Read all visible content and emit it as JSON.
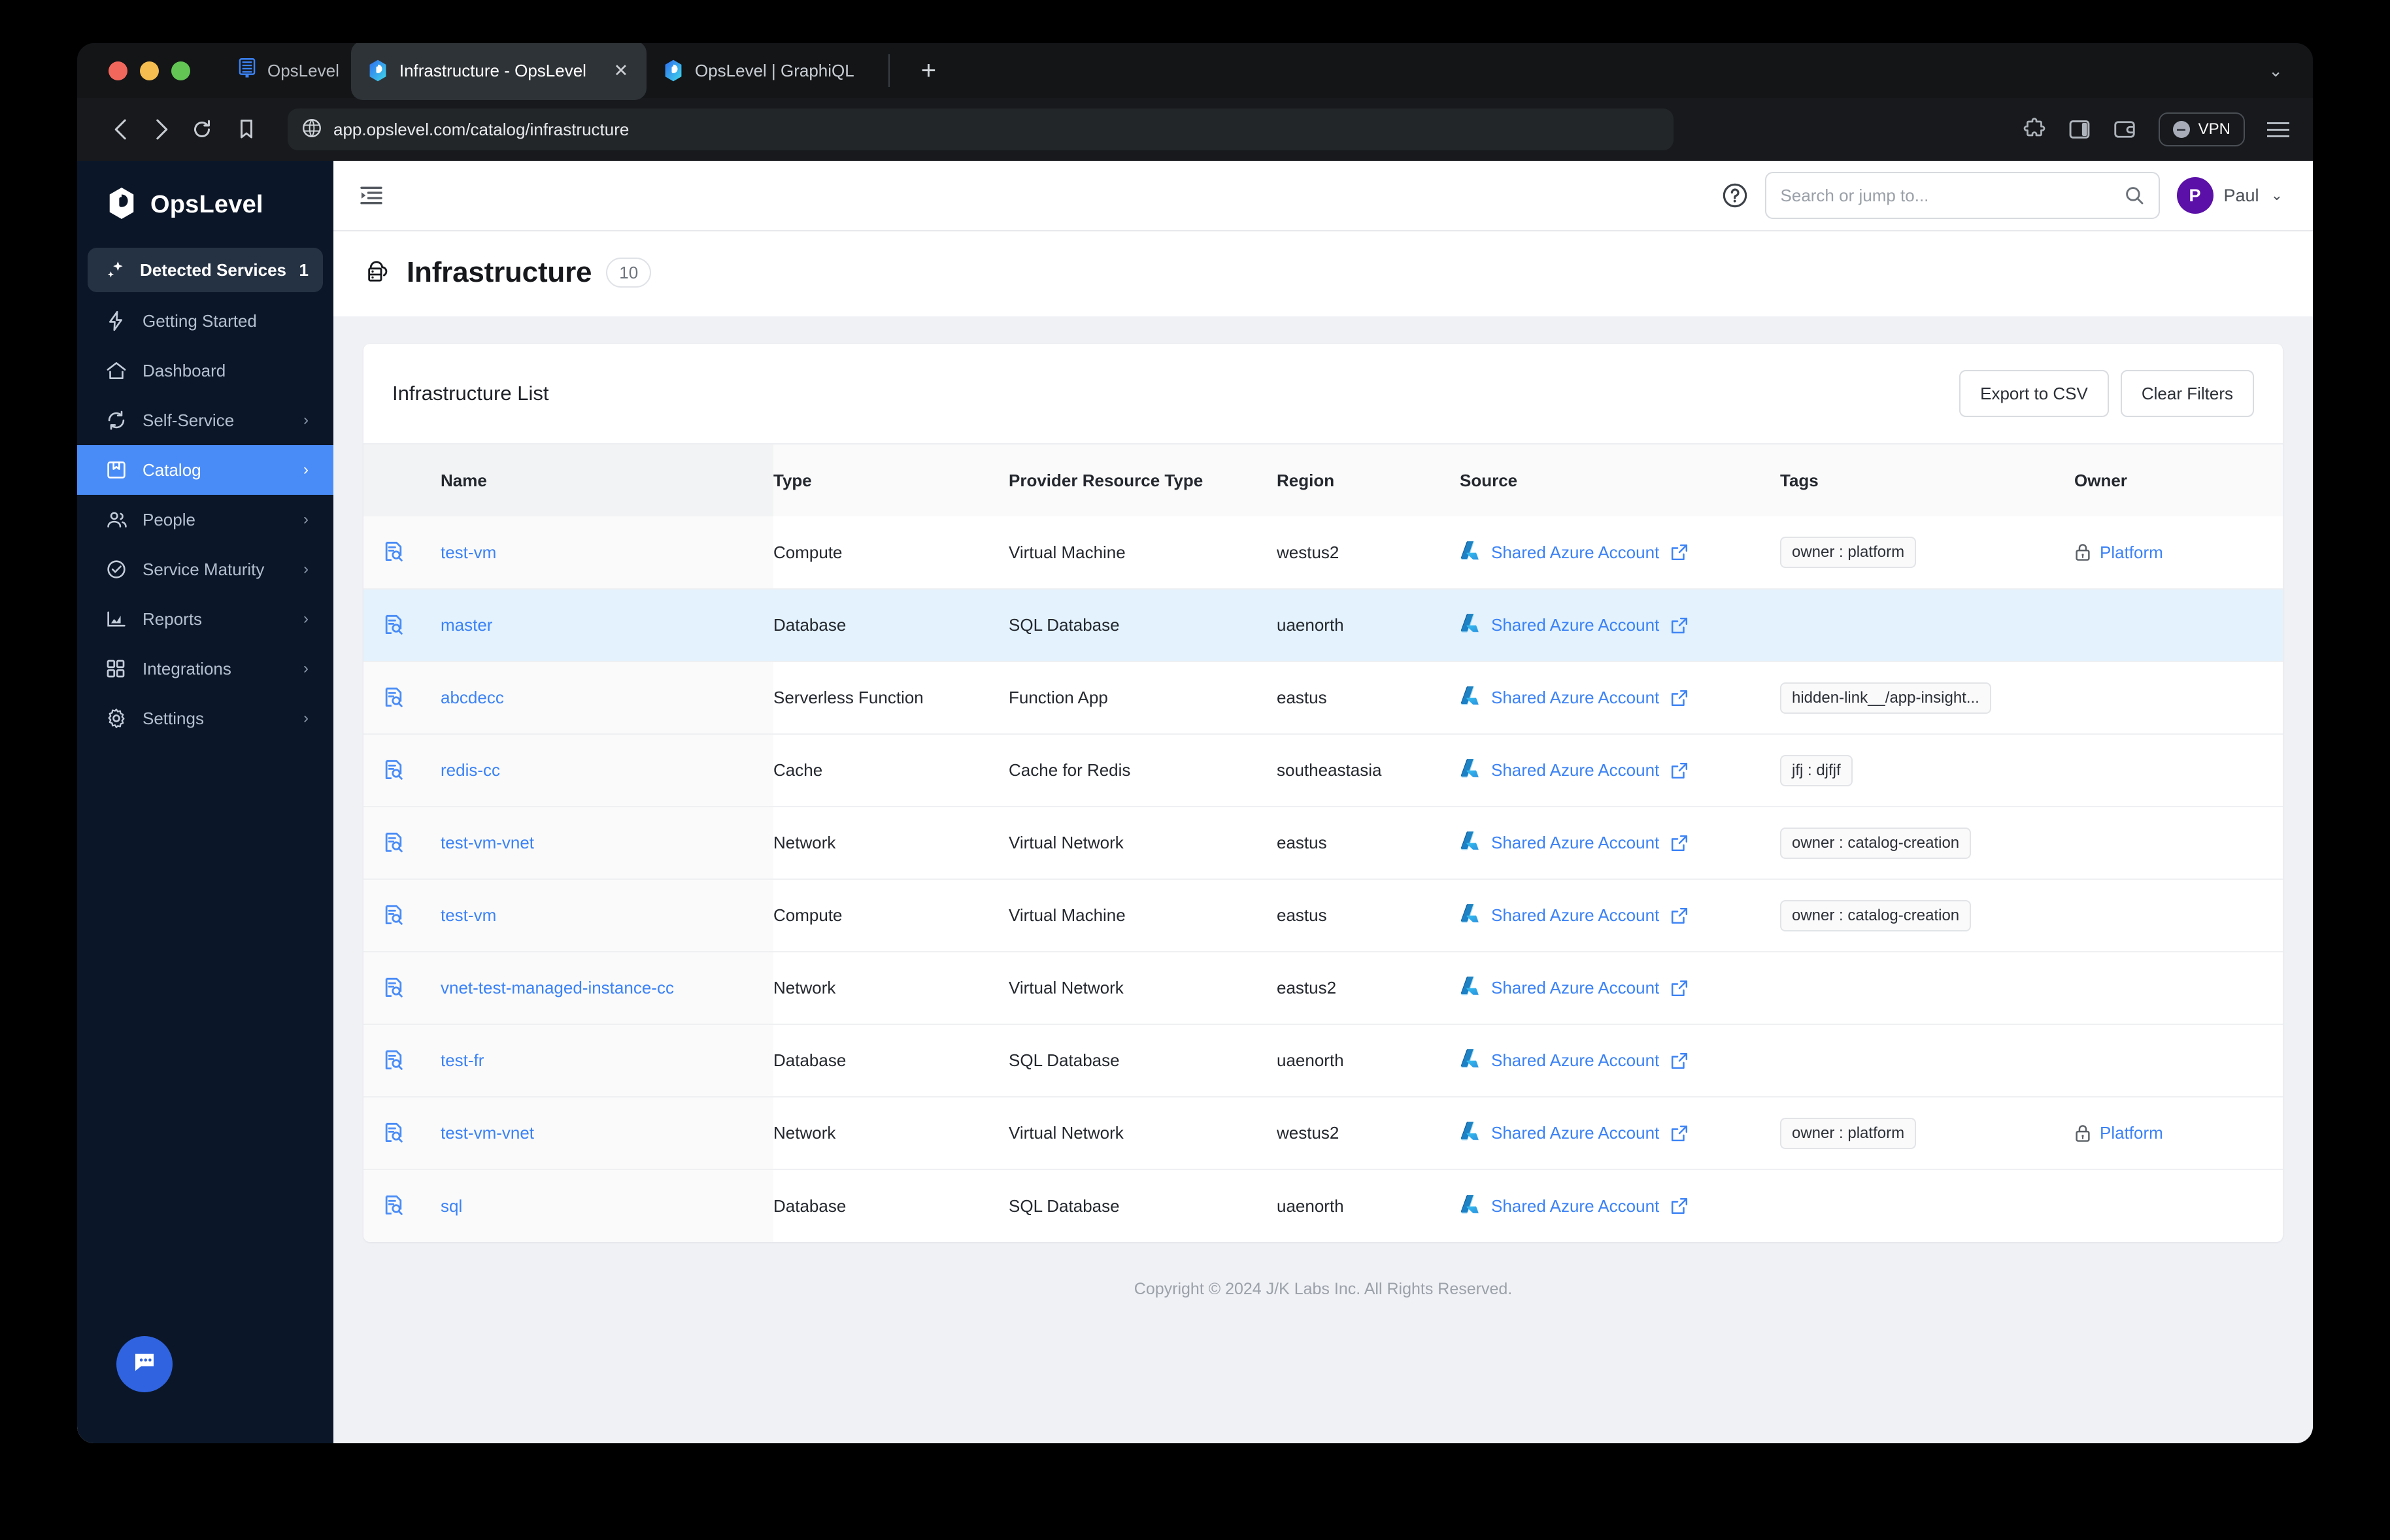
{
  "browser": {
    "app_tab_label": "OpsLevel",
    "tabs": [
      {
        "title": "Infrastructure - OpsLevel",
        "active": true,
        "close_label": "✕"
      },
      {
        "title": "OpsLevel | GraphiQL",
        "active": false,
        "close_label": ""
      }
    ],
    "new_tab_label": "+",
    "url": "app.opslevel.com/catalog/infrastructure",
    "vpn_label": "VPN",
    "tabstrip_chevron": "⌄"
  },
  "sidebar": {
    "brand": "OpsLevel",
    "items": [
      {
        "label": "Detected Services",
        "icon": "sparkles-icon",
        "badge": "1",
        "variant": "detected"
      },
      {
        "label": "Getting Started",
        "icon": "bolt-icon",
        "arrow": ""
      },
      {
        "label": "Dashboard",
        "icon": "home-icon",
        "arrow": ""
      },
      {
        "label": "Self-Service",
        "icon": "refresh-icon",
        "arrow": "›"
      },
      {
        "label": "Catalog",
        "icon": "catalog-icon",
        "arrow": "›",
        "variant": "active"
      },
      {
        "label": "People",
        "icon": "people-icon",
        "arrow": "›"
      },
      {
        "label": "Service Maturity",
        "icon": "check-circle-icon",
        "arrow": "›"
      },
      {
        "label": "Reports",
        "icon": "chart-icon",
        "arrow": "›"
      },
      {
        "label": "Integrations",
        "icon": "grid-icon",
        "arrow": "›"
      },
      {
        "label": "Settings",
        "icon": "gear-icon",
        "arrow": "›"
      }
    ]
  },
  "topbar": {
    "search_placeholder": "Search or jump to...",
    "user_initial": "P",
    "user_name": "Paul",
    "user_chevron": "⌄"
  },
  "page": {
    "title": "Infrastructure",
    "count": "10"
  },
  "card": {
    "title": "Infrastructure List",
    "export_label": "Export to CSV",
    "clear_label": "Clear Filters"
  },
  "table": {
    "columns": [
      "Name",
      "Type",
      "Provider Resource Type",
      "Region",
      "Source",
      "Tags",
      "Owner"
    ],
    "rows": [
      {
        "name": "test-vm",
        "type": "Compute",
        "provider_resource_type": "Virtual Machine",
        "region": "westus2",
        "source": "Shared Azure Account",
        "tags": [
          "owner : platform"
        ],
        "owner": "Platform",
        "selected": false
      },
      {
        "name": "master",
        "type": "Database",
        "provider_resource_type": "SQL Database",
        "region": "uaenorth",
        "source": "Shared Azure Account",
        "tags": [],
        "owner": "",
        "selected": true
      },
      {
        "name": "abcdecc",
        "type": "Serverless Function",
        "provider_resource_type": "Function App",
        "region": "eastus",
        "source": "Shared Azure Account",
        "tags": [
          "hidden-link__/app-insight..."
        ],
        "owner": "",
        "selected": false
      },
      {
        "name": "redis-cc",
        "type": "Cache",
        "provider_resource_type": "Cache for Redis",
        "region": "southeastasia",
        "source": "Shared Azure Account",
        "tags": [
          "jfj : djfjf"
        ],
        "owner": "",
        "selected": false
      },
      {
        "name": "test-vm-vnet",
        "type": "Network",
        "provider_resource_type": "Virtual Network",
        "region": "eastus",
        "source": "Shared Azure Account",
        "tags": [
          "owner : catalog-creation"
        ],
        "owner": "",
        "selected": false
      },
      {
        "name": "test-vm",
        "type": "Compute",
        "provider_resource_type": "Virtual Machine",
        "region": "eastus",
        "source": "Shared Azure Account",
        "tags": [
          "owner : catalog-creation"
        ],
        "owner": "",
        "selected": false
      },
      {
        "name": "vnet-test-managed-instance-cc",
        "type": "Network",
        "provider_resource_type": "Virtual Network",
        "region": "eastus2",
        "source": "Shared Azure Account",
        "tags": [],
        "owner": "",
        "selected": false
      },
      {
        "name": "test-fr",
        "type": "Database",
        "provider_resource_type": "SQL Database",
        "region": "uaenorth",
        "source": "Shared Azure Account",
        "tags": [],
        "owner": "",
        "selected": false
      },
      {
        "name": "test-vm-vnet",
        "type": "Network",
        "provider_resource_type": "Virtual Network",
        "region": "westus2",
        "source": "Shared Azure Account",
        "tags": [
          "owner : platform"
        ],
        "owner": "Platform",
        "selected": false
      },
      {
        "name": "sql",
        "type": "Database",
        "provider_resource_type": "SQL Database",
        "region": "uaenorth",
        "source": "Shared Azure Account",
        "tags": [],
        "owner": "",
        "selected": false
      }
    ]
  },
  "footer": {
    "copyright": "Copyright © 2024 J/K Labs Inc. All Rights Reserved."
  },
  "colors": {
    "sidebar_bg": "#0b1628",
    "sidebar_active": "#4a8cf7",
    "link_blue": "#3b82f6",
    "row_selected": "#e3f2fd",
    "avatar_purple": "#5b10a8",
    "chat_fab": "#2f63e0"
  }
}
